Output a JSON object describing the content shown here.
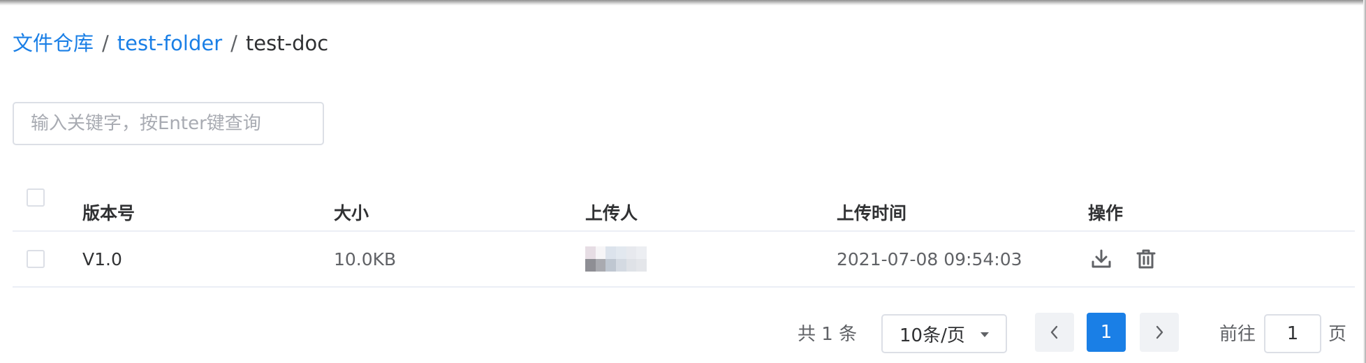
{
  "breadcrumb": {
    "root": "文件仓库",
    "folder": "test-folder",
    "current": "test-doc",
    "separator": "/"
  },
  "search": {
    "placeholder": "输入关键字，按Enter键查询",
    "value": ""
  },
  "table": {
    "columns": {
      "version": "版本号",
      "size": "大小",
      "uploader": "上传人",
      "upload_time": "上传时间",
      "actions": "操作"
    },
    "rows": [
      {
        "version": "V1.0",
        "size": "10.0KB",
        "uploader": "",
        "upload_time": "2021-07-08 09:54:03",
        "actions": [
          "download-icon",
          "delete-icon"
        ]
      }
    ]
  },
  "pagination": {
    "total_text": "共 1 条",
    "page_size": "10条/页",
    "current_page": "1",
    "goto_label": "前往",
    "goto_value": "1",
    "page_unit": "页"
  },
  "colors": {
    "accent": "#1a7fe6",
    "text_primary": "#303133",
    "text_regular": "#606266",
    "border": "#dcdfe6",
    "pager_bg": "#f0f2f5"
  }
}
